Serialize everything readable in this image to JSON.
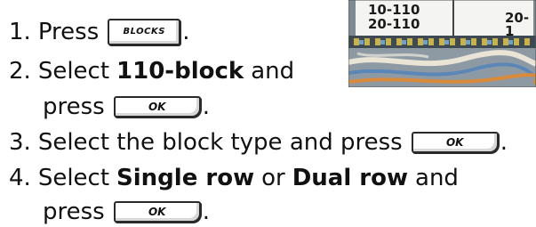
{
  "steps": [
    {
      "num": "1.",
      "pre": "Press",
      "key": "BLOCKS",
      "post": "."
    },
    {
      "num": "2.",
      "pre": "Select",
      "bold": "110-block",
      "mid": "and",
      "cont_pre": "press",
      "key": "OK",
      "post": "."
    },
    {
      "num": "3.",
      "pre": "Select the block type and press",
      "key": "OK",
      "post": "."
    },
    {
      "num": "4.",
      "pre": "Select",
      "bold1": "Single row",
      "or": "or",
      "bold2": "Dual row",
      "mid": "and",
      "cont_pre": "press",
      "key": "OK",
      "post": "."
    }
  ],
  "photo": {
    "labels": [
      "10-110",
      "20-110",
      "20-1"
    ]
  }
}
